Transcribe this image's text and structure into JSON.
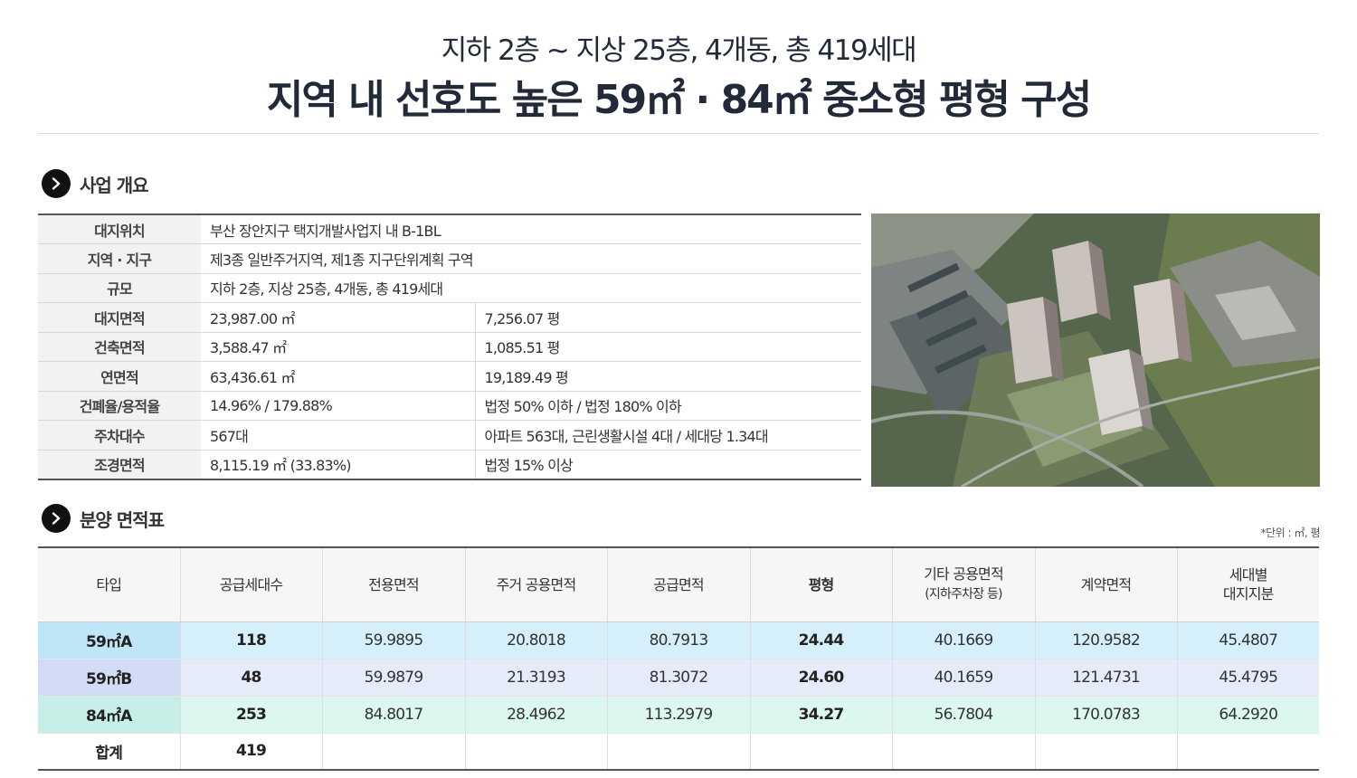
{
  "header": {
    "subtitle": "지하 2층 ~ 지상 25층, 4개동, 총 419세대",
    "title_pre": "지역 내 선호도 높은 59㎡ · 84㎡ 중소형 평형 구성"
  },
  "overview": {
    "heading": "사업 개요",
    "rows": [
      {
        "label": "대지위치",
        "v1": "부산 장안지구 택지개발사업지 내 B-1BL",
        "v2": ""
      },
      {
        "label": "지역 · 지구",
        "v1": "제3종 일반주거지역, 제1종 지구단위계획 구역",
        "v2": ""
      },
      {
        "label": "규모",
        "v1": "지하 2층, 지상 25층, 4개동, 총 419세대",
        "v2": ""
      },
      {
        "label": "대지면적",
        "v1": "23,987.00 ㎡",
        "v2": "7,256.07 평"
      },
      {
        "label": "건축면적",
        "v1": "3,588.47 ㎡",
        "v2": "1,085.51 평"
      },
      {
        "label": "연면적",
        "v1": "63,436.61 ㎡",
        "v2": "19,189.49 평"
      },
      {
        "label": "건폐율/용적율",
        "v1": "14.96% / 179.88%",
        "v2": "법정 50% 이하 / 법정 180% 이하"
      },
      {
        "label": "주차대수",
        "v1": "567대",
        "v2": "아파트 563대, 근린생활시설 4대 / 세대당 1.34대"
      },
      {
        "label": "조경면적",
        "v1": "8,115.19 ㎡ (33.83%)",
        "v2": "법정 15% 이상"
      }
    ]
  },
  "areas": {
    "heading": "분양 면적표",
    "unit_note": "*단위 : ㎡, 평",
    "columns": [
      "타입",
      "공급세대수",
      "전용면적",
      "주거 공용면적",
      "공급면적",
      "평형",
      "기타 공용면적",
      "(지하주차장 등)",
      "계약면적",
      "세대별",
      "대지지분"
    ],
    "rows": [
      {
        "type": "59㎡A",
        "units": "118",
        "exclusive": "59.9895",
        "res_common": "20.8018",
        "supply": "80.7913",
        "pyeong": "24.44",
        "other_common": "40.1669",
        "contract": "120.9582",
        "land": "45.4807"
      },
      {
        "type": "59㎡B",
        "units": "48",
        "exclusive": "59.9879",
        "res_common": "21.3193",
        "supply": "81.3072",
        "pyeong": "24.60",
        "other_common": "40.1659",
        "contract": "121.4731",
        "land": "45.4795"
      },
      {
        "type": "84㎡A",
        "units": "253",
        "exclusive": "84.8017",
        "res_common": "28.4962",
        "supply": "113.2979",
        "pyeong": "34.27",
        "other_common": "56.7804",
        "contract": "170.0783",
        "land": "64.2920"
      },
      {
        "type": "합계",
        "units": "419",
        "exclusive": "",
        "res_common": "",
        "supply": "",
        "pyeong": "",
        "other_common": "",
        "contract": "",
        "land": ""
      }
    ],
    "row_colors": {
      "a": [
        "#bfe6f6",
        "#d5f0fb"
      ],
      "b": [
        "#d3dcf7",
        "#e6ebfa"
      ],
      "c": [
        "#c6efe7",
        "#dcf6f0"
      ],
      "total": [
        "#ffffff",
        "#ffffff"
      ]
    }
  }
}
